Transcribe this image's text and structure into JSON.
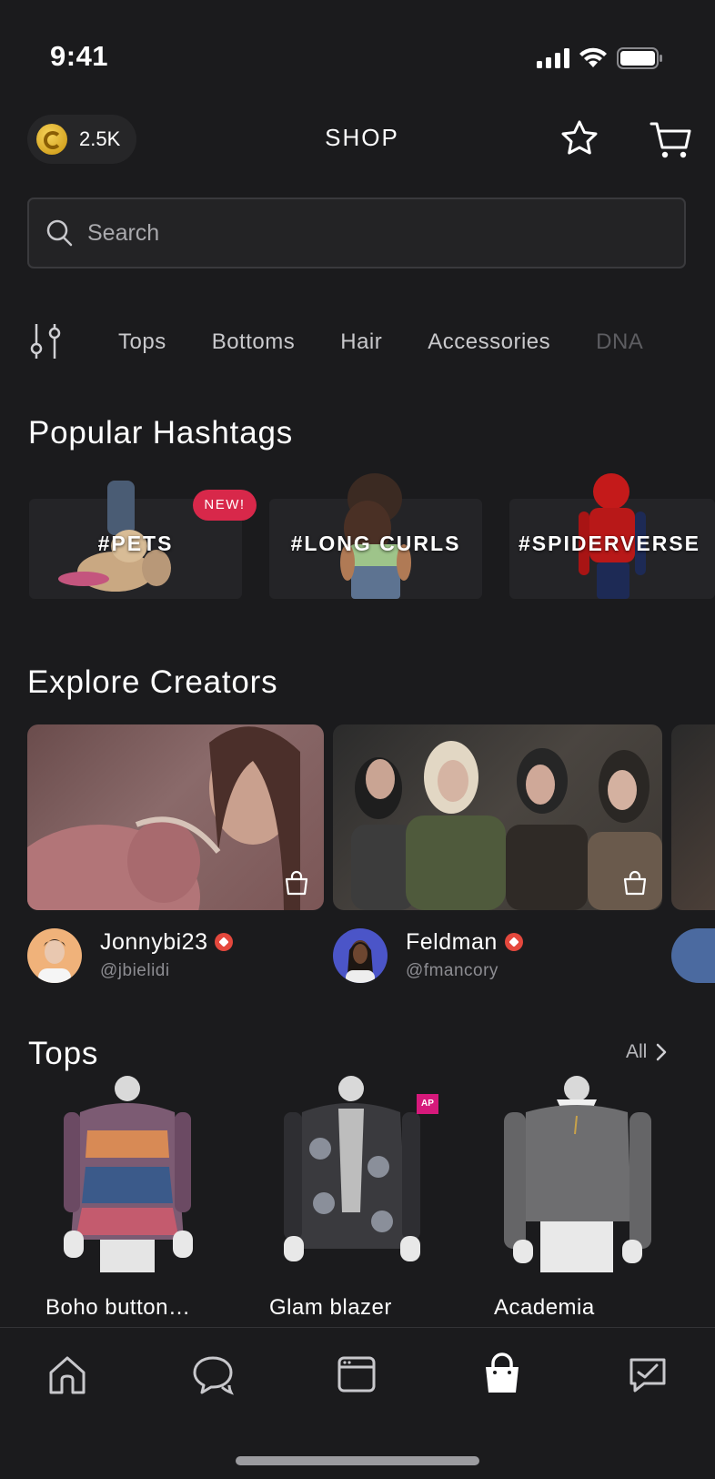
{
  "status_bar": {
    "time": "9:41"
  },
  "header": {
    "coins": "2.5K",
    "title": "SHOP"
  },
  "search": {
    "placeholder": "Search"
  },
  "categories": [
    "Tops",
    "Bottoms",
    "Hair",
    "Accessories",
    "DNA"
  ],
  "hashtags": {
    "title": "Popular Hashtags",
    "items": [
      {
        "label": "#PETS",
        "badge": "NEW!"
      },
      {
        "label": "#LONG CURLS"
      },
      {
        "label": "#SPIDERVERSE"
      }
    ]
  },
  "creators": {
    "title": "Explore Creators",
    "items": [
      {
        "name": "Jonnybi23",
        "handle": "@jbielidi"
      },
      {
        "name": "Feldman",
        "handle": "@fmancory"
      }
    ]
  },
  "tops": {
    "title": "Tops",
    "all_label": "All",
    "items": [
      {
        "name": "Boho button…"
      },
      {
        "name": "Glam blazer",
        "badge": "AP"
      },
      {
        "name": "Academia"
      }
    ]
  },
  "tab_bar": [
    "home-icon",
    "chat-icon",
    "feed-icon",
    "shop-icon",
    "activity-icon"
  ],
  "colors": {
    "background": "#1b1b1d",
    "new_badge": "#d8284a",
    "ap_badge": "#d6197b",
    "coin": "#e0b22e"
  }
}
